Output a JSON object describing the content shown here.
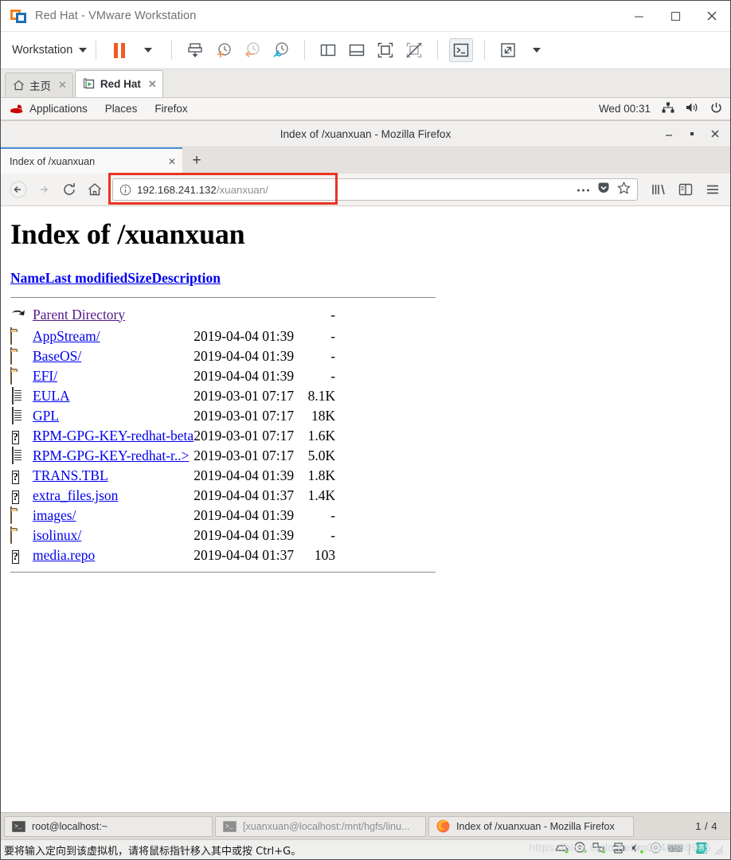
{
  "vmware": {
    "window_title": "Red Hat - VMware Workstation",
    "logo_icon": "vmware-logo-icon",
    "window_buttons": [
      {
        "name": "minimize-button",
        "glyph": "—"
      },
      {
        "name": "maximize-button",
        "glyph": "□"
      },
      {
        "name": "close-button",
        "glyph": "✕"
      }
    ],
    "toolbar": {
      "workstation_label": "Workstation",
      "items": [
        {
          "name": "suspend-button",
          "icon": "pause-icon"
        },
        {
          "name": "power-dropdown-button",
          "icon": "chevron-down-icon"
        },
        {
          "name": "manage-snapshots-button",
          "icon": "snapshot-stack-icon"
        },
        {
          "name": "take-snapshot-button",
          "icon": "clock-plus-icon"
        },
        {
          "name": "revert-snapshot-button",
          "icon": "clock-back-icon"
        },
        {
          "name": "snapshot-manager-button",
          "icon": "clock-wrench-icon"
        },
        {
          "name": "show-left-pane-button",
          "icon": "panel-left-icon"
        },
        {
          "name": "show-bottom-pane-button",
          "icon": "panel-bottom-icon"
        },
        {
          "name": "show-thumbnails-button",
          "icon": "thumbnail-bar-icon"
        },
        {
          "name": "hide-thumbnails-button",
          "icon": "thumbnail-bar-off-icon"
        },
        {
          "name": "console-view-button",
          "icon": "terminal-icon",
          "active": true
        },
        {
          "name": "fullscreen-button",
          "icon": "expand-arrows-icon"
        },
        {
          "name": "fullscreen-dropdown-button",
          "icon": "chevron-down-icon"
        }
      ]
    },
    "vm_tabs": [
      {
        "name": "tab-home",
        "label": "主页",
        "icon": "home-icon",
        "selected": false
      },
      {
        "name": "tab-red-hat",
        "label": "Red Hat",
        "icon": "vm-play-icon",
        "selected": true
      }
    ],
    "status_message": "要将输入定向到该虚拟机，请将鼠标指针移入其中或按 Ctrl+G。",
    "status_icons": [
      {
        "name": "hard-disk-status-icon"
      },
      {
        "name": "cd-drive-status-icon"
      },
      {
        "name": "network-status-icon"
      },
      {
        "name": "printer-status-icon"
      },
      {
        "name": "sound-status-icon"
      },
      {
        "name": "usb-status-icon"
      },
      {
        "name": "keyboard-status-icon"
      },
      {
        "name": "vmware-tools-status-icon"
      }
    ],
    "watermark": "https://blog.csdn.net/m0_46989935"
  },
  "guest": {
    "top_bar": {
      "items": [
        {
          "name": "gnome-applications-menu",
          "label": "Applications"
        },
        {
          "name": "gnome-places-menu",
          "label": "Places"
        },
        {
          "name": "gnome-firefox-menu",
          "label": "Firefox"
        }
      ],
      "redhat_icon": "redhat-hat-icon",
      "clock": "Wed 00:31",
      "tray": [
        {
          "name": "network-tray-icon"
        },
        {
          "name": "volume-tray-icon"
        },
        {
          "name": "power-tray-icon"
        }
      ]
    },
    "taskbar": {
      "buttons": [
        {
          "name": "taskbar-item-terminal-root",
          "label": "root@localhost:~",
          "icon": "terminal-icon",
          "active": true
        },
        {
          "name": "taskbar-item-terminal-xuanxuan",
          "label": "[xuanxuan@localhost:/mnt/hgfs/linu...",
          "icon": "terminal-icon",
          "active": false
        },
        {
          "name": "taskbar-item-firefox",
          "label": "Index of /xuanxuan - Mozilla Firefox",
          "icon": "firefox-icon",
          "active": false
        }
      ],
      "workspace_indicator": "1 / 4"
    }
  },
  "firefox": {
    "window_title": "Index of /xuanxuan - Mozilla Firefox",
    "window_buttons": [
      {
        "name": "ff-minimize-button",
        "glyph": "—"
      },
      {
        "name": "ff-maximize-button",
        "glyph": "■"
      },
      {
        "name": "ff-close-button",
        "glyph": "✕"
      }
    ],
    "tabs": [
      {
        "name": "browser-tab-index-of-xuanxuan",
        "label": "Index of /xuanxuan",
        "close_glyph": "✕"
      }
    ],
    "new_tab_glyph": "+",
    "nav": {
      "back_icon": "arrow-back-icon",
      "forward_icon": "arrow-forward-icon",
      "reload_icon": "reload-icon",
      "home_icon": "home-icon"
    },
    "urlbar": {
      "identity_icon": "info-circle-icon",
      "url_host": "192.168.241.132",
      "url_path": "/xuanxuan/",
      "page_actions_icon": "ellipsis-icon",
      "pocket_icon": "pocket-icon",
      "bookmark_icon": "star-icon",
      "highlight_color": "#ea3323"
    },
    "right_icons": [
      {
        "name": "library-icon"
      },
      {
        "name": "sidebar-icon"
      },
      {
        "name": "hamburger-menu-icon"
      }
    ]
  },
  "page": {
    "heading": "Index of /xuanxuan",
    "columns": [
      {
        "name": "column-header-name",
        "label": "Name"
      },
      {
        "name": "column-header-last-modified",
        "label": "Last modified"
      },
      {
        "name": "column-header-size",
        "label": "Size"
      },
      {
        "name": "column-header-description",
        "label": "Description"
      }
    ],
    "rows": [
      {
        "icon": "parent-directory-icon",
        "name": "Parent Directory",
        "modified": "",
        "size": "-",
        "visited": true
      },
      {
        "icon": "folder-icon",
        "name": "AppStream/",
        "modified": "2019-04-04 01:39",
        "size": "-"
      },
      {
        "icon": "folder-icon",
        "name": "BaseOS/",
        "modified": "2019-04-04 01:39",
        "size": "-"
      },
      {
        "icon": "folder-icon",
        "name": "EFI/",
        "modified": "2019-04-04 01:39",
        "size": "-"
      },
      {
        "icon": "text-file-icon",
        "name": "EULA",
        "modified": "2019-03-01 07:17",
        "size": "8.1K"
      },
      {
        "icon": "text-file-icon",
        "name": "GPL",
        "modified": "2019-03-01 07:17",
        "size": "18K"
      },
      {
        "icon": "unknown-file-icon",
        "name": "RPM-GPG-KEY-redhat-beta",
        "modified": "2019-03-01 07:17",
        "size": "1.6K"
      },
      {
        "icon": "text-file-icon",
        "name": "RPM-GPG-KEY-redhat-r..>",
        "modified": "2019-03-01 07:17",
        "size": "5.0K"
      },
      {
        "icon": "unknown-file-icon",
        "name": "TRANS.TBL",
        "modified": "2019-04-04 01:39",
        "size": "1.8K"
      },
      {
        "icon": "unknown-file-icon",
        "name": "extra_files.json",
        "modified": "2019-04-04 01:37",
        "size": "1.4K"
      },
      {
        "icon": "folder-icon",
        "name": "images/",
        "modified": "2019-04-04 01:39",
        "size": "-"
      },
      {
        "icon": "folder-icon",
        "name": "isolinux/",
        "modified": "2019-04-04 01:39",
        "size": "-"
      },
      {
        "icon": "unknown-file-icon",
        "name": "media.repo",
        "modified": "2019-04-04 01:37",
        "size": "103"
      }
    ]
  }
}
